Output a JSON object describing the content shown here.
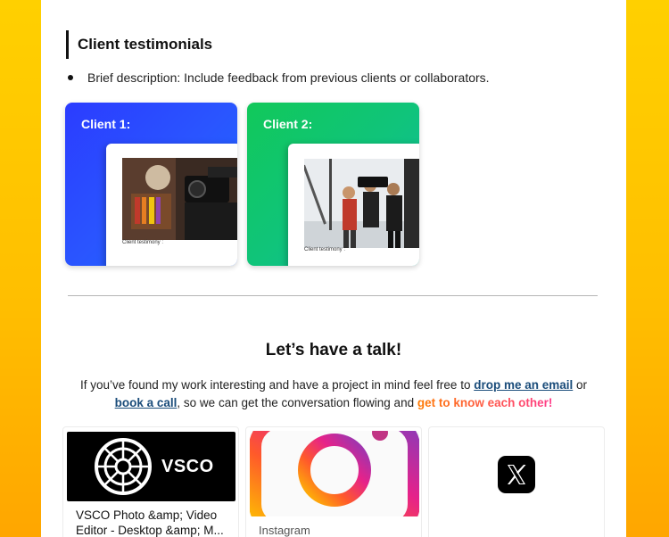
{
  "testimonials": {
    "heading": "Client testimonials",
    "bullet": "Brief description: Include feedback from previous clients or collaborators.",
    "cards": [
      {
        "title": "Client 1:",
        "caption": "Client testimony :"
      },
      {
        "title": "Client 2:",
        "caption": "Client testimony :"
      }
    ]
  },
  "contact": {
    "title": "Let’s have a talk!",
    "text_before": "If you’ve found my work interesting and have a project in mind feel free to ",
    "email_link": "drop me an email",
    "text_or": " or",
    "call_link": "book a call",
    "text_middle": ", so we can get the conversation flowing and ",
    "highlight": "get to know each other!"
  },
  "tiles": [
    {
      "logo_text": "VSCO",
      "label": "VSCO Photo &amp; Video Editor - Desktop &amp; M...",
      "icon": "vsco-logo-icon"
    },
    {
      "label": "Instagram",
      "icon": "instagram-icon"
    },
    {
      "label": "",
      "icon": "x-logo-icon"
    }
  ],
  "colors": {
    "background": "#ffc400",
    "card1": "#2a4bff",
    "card2": "#12c46a",
    "link": "#1a4c7a",
    "highlight_start": "#ff7a00",
    "highlight_end": "#ff3b8a"
  }
}
